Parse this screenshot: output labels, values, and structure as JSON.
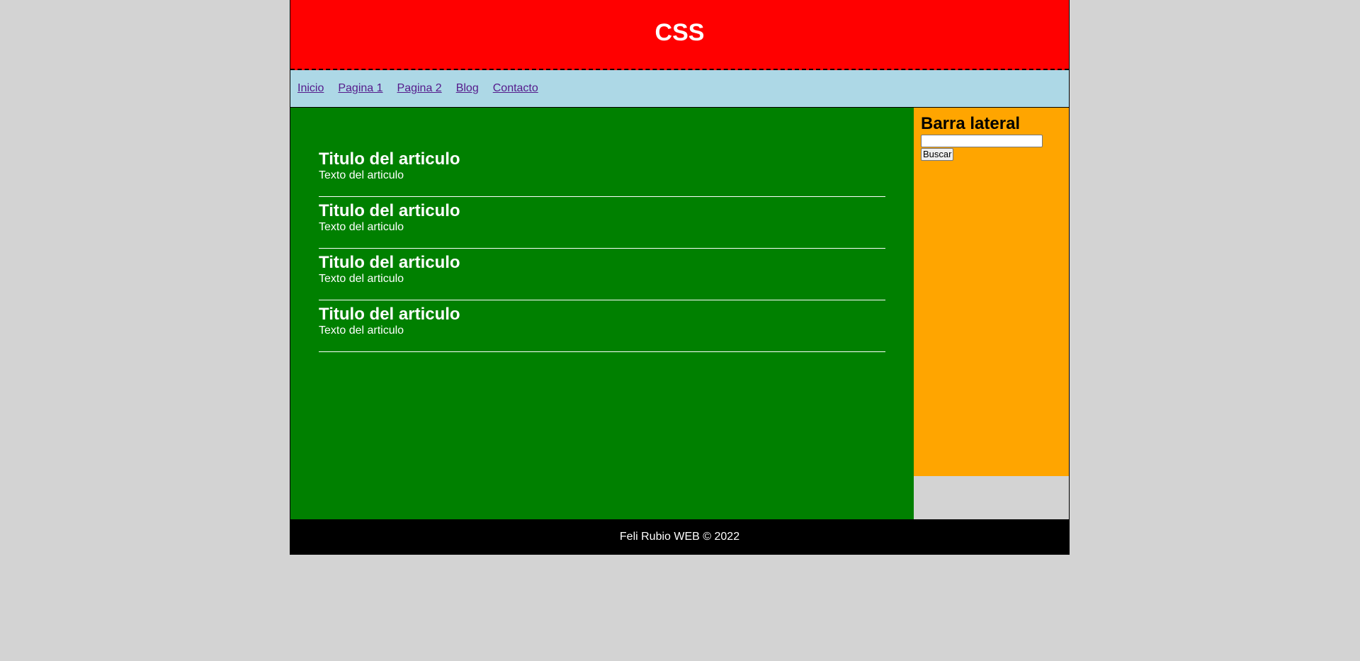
{
  "header": {
    "title": "CSS"
  },
  "nav": {
    "items": [
      {
        "label": "Inicio"
      },
      {
        "label": "Pagina 1"
      },
      {
        "label": "Pagina 2"
      },
      {
        "label": "Blog"
      },
      {
        "label": "Contacto"
      }
    ]
  },
  "main": {
    "articles": [
      {
        "title": "Titulo del articulo",
        "text": "Texto del articulo"
      },
      {
        "title": "Titulo del articulo",
        "text": "Texto del articulo"
      },
      {
        "title": "Titulo del articulo",
        "text": "Texto del articulo"
      },
      {
        "title": "Titulo del articulo",
        "text": "Texto del articulo"
      }
    ]
  },
  "sidebar": {
    "title": "Barra lateral",
    "search_value": "",
    "search_button": "Buscar"
  },
  "footer": {
    "text": "Feli Rubio WEB © 2022"
  },
  "colors": {
    "page_background": "#d3d3d3",
    "header": "#ff0000",
    "nav": "#add8e6",
    "main": "#008000",
    "sidebar": "#ffa500",
    "footer": "#000000",
    "link": "#551a8b"
  }
}
